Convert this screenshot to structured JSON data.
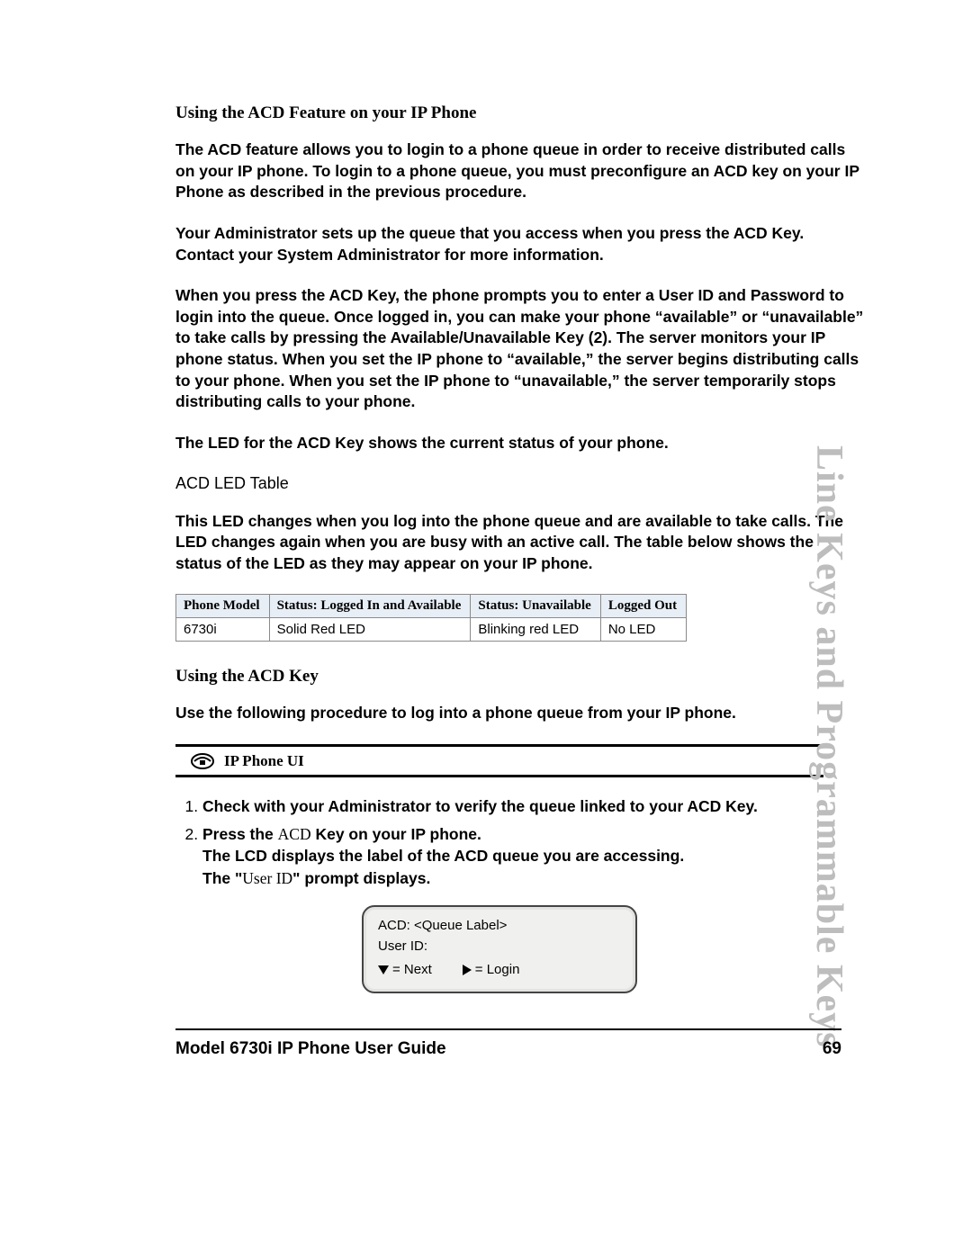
{
  "side_label": "Line Keys and Programmable Keys",
  "section_title": "Using the ACD Feature on your IP Phone",
  "p1": "The ACD feature allows you to login to a phone queue in order to receive distributed calls on your IP phone. To login to a phone queue, you must preconfigure an ACD key on your IP Phone as described in the previous procedure.",
  "p2": "Your Administrator sets up the queue that you access when you press the ACD Key. Contact your System Administrator for more information.",
  "p3": "When you press the ACD Key, the phone prompts you to enter a User ID and Password to login into the queue. Once logged in, you can make your phone “available” or “unavailable” to take calls by pressing the Available/Unavailable Key (2). The server monitors your IP phone status. When you set the IP phone to “available,” the server begins distributing calls to your phone. When you set the IP phone to “unavailable,” the server temporarily stops distributing calls to your phone.",
  "p4": "The LED for the ACD Key shows the current status of your phone.",
  "led_caption": "ACD LED Table",
  "p5": "This LED changes when you log into the phone queue and are available to take calls. The LED changes again when you are busy with an active call. The table below shows the status of the LED as they may appear on your IP phone.",
  "led_table": {
    "headers": [
      "Phone Model",
      "Status: Logged In and Available",
      "Status: Unavailable",
      "Logged Out"
    ],
    "row": [
      "6730i",
      "Solid Red LED",
      "Blinking red LED",
      "No LED"
    ]
  },
  "section_title_2": "Using the ACD Key",
  "p6": "Use the following procedure to log into a phone queue from your IP phone.",
  "ui_banner": "IP Phone UI",
  "steps": {
    "s1": "Check with your Administrator to verify the queue linked to your ACD Key.",
    "s2_a": "Press the ",
    "s2_b": "ACD",
    "s2_c": " Key on your IP phone.",
    "s2_d": "The LCD displays the label of the ACD queue you are accessing.",
    "s2_e_a": "The \"",
    "s2_e_b": "User ID",
    "s2_e_c": "\" prompt displays."
  },
  "lcd": {
    "line1": "ACD: <Queue Label>",
    "line2": "User ID:",
    "next_label": "= Next",
    "login_label": "= Login"
  },
  "footer_left": "Model 6730i IP Phone User Guide",
  "footer_right": "69"
}
